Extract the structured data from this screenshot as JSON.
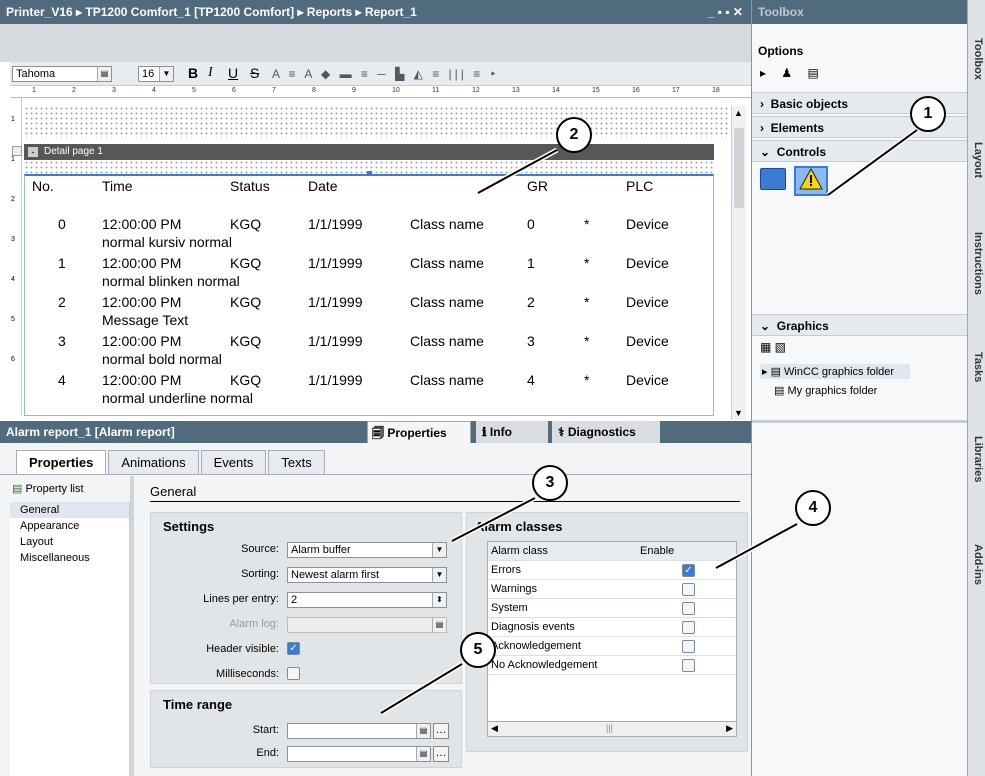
{
  "editor": {
    "breadcrumb": "Printer_V16  ▸  TP1200 Comfort_1 [TP1200 Comfort]  ▸  Reports  ▸  Report_1",
    "win_controls": "_ ▪ ▪ ✕",
    "font_name": "Tahoma",
    "font_size": "16",
    "fmt_bold": "B",
    "fmt_italic": "I",
    "fmt_underline": "U",
    "fmt_strike": "S",
    "ruler_marks": [
      "1",
      "2",
      "3",
      "4",
      "5",
      "6",
      "7",
      "8",
      "9",
      "10",
      "11",
      "12",
      "13",
      "14",
      "15",
      "16",
      "17",
      "18"
    ],
    "vruler_marks": [
      "1",
      "1",
      "2",
      "3",
      "4",
      "5",
      "6"
    ],
    "section_label": "Detail page 1",
    "columns": [
      "No.",
      "Time",
      "Status",
      "Date",
      "",
      "GR",
      "",
      "PLC"
    ],
    "rows": [
      {
        "no": "0",
        "time": "12:00:00 PM",
        "status": "KGQ",
        "date": "1/1/1999",
        "cls": "Class name",
        "gr": "0",
        "star": "*",
        "plc": "Device",
        "text": "normal kursiv normal"
      },
      {
        "no": "1",
        "time": "12:00:00 PM",
        "status": "KGQ",
        "date": "1/1/1999",
        "cls": "Class name",
        "gr": "1",
        "star": "*",
        "plc": "Device",
        "text": "normal blinken normal"
      },
      {
        "no": "2",
        "time": "12:00:00 PM",
        "status": "KGQ",
        "date": "1/1/1999",
        "cls": "Class name",
        "gr": "2",
        "star": "*",
        "plc": "Device",
        "text": "Message Text"
      },
      {
        "no": "3",
        "time": "12:00:00 PM",
        "status": "KGQ",
        "date": "1/1/1999",
        "cls": "Class name",
        "gr": "3",
        "star": "*",
        "plc": "Device",
        "text": "normal bold normal"
      },
      {
        "no": "4",
        "time": "12:00:00 PM",
        "status": "KGQ",
        "date": "1/1/1999",
        "cls": "Class name",
        "gr": "4",
        "star": "*",
        "plc": "Device",
        "text": "normal underline normal"
      }
    ]
  },
  "inspector": {
    "title": "Alarm report_1 [Alarm report]",
    "tab_properties": "Properties",
    "tab_info": "Info",
    "tab_diagnostics": "Diagnostics",
    "tabs": [
      "Properties",
      "Animations",
      "Events",
      "Texts"
    ],
    "property_list": "Property list",
    "side_items": [
      "General",
      "Appearance",
      "Layout",
      "Miscellaneous"
    ],
    "general_heading": "General",
    "settings": {
      "title": "Settings",
      "source_label": "Source:",
      "source_value": "Alarm buffer",
      "sorting_label": "Sorting:",
      "sorting_value": "Newest alarm first",
      "lines_label": "Lines per entry:",
      "lines_value": "2",
      "alarmlog_label": "Alarm log:",
      "header_label": "Header visible:",
      "ms_label": "Milliseconds:"
    },
    "timerange": {
      "title": "Time range",
      "start_label": "Start:",
      "end_label": "End:"
    },
    "alarm_classes": {
      "title": "Alarm classes",
      "col_class": "Alarm class",
      "col_enable": "Enable",
      "rows": [
        {
          "name": "Errors",
          "enabled": true
        },
        {
          "name": "Warnings",
          "enabled": false
        },
        {
          "name": "System",
          "enabled": false
        },
        {
          "name": "Diagnosis events",
          "enabled": false
        },
        {
          "name": "Acknowledgement",
          "enabled": false
        },
        {
          "name": "No Acknowledgement",
          "enabled": false
        }
      ]
    }
  },
  "toolbox": {
    "title": "Toolbox",
    "options": "Options",
    "basic": "Basic objects",
    "elements": "Elements",
    "controls": "Controls",
    "graphics": "Graphics",
    "folder1": "WinCC graphics folder",
    "folder2": "My graphics folder"
  },
  "side_tabs": [
    "Toolbox",
    "Layout",
    "Instructions",
    "Tasks",
    "Libraries",
    "Add-ins"
  ],
  "callouts": [
    "1",
    "2",
    "3",
    "4",
    "5"
  ],
  "colors": {
    "titlebar": "#4f6b7d",
    "accent": "#3a7bd5"
  }
}
